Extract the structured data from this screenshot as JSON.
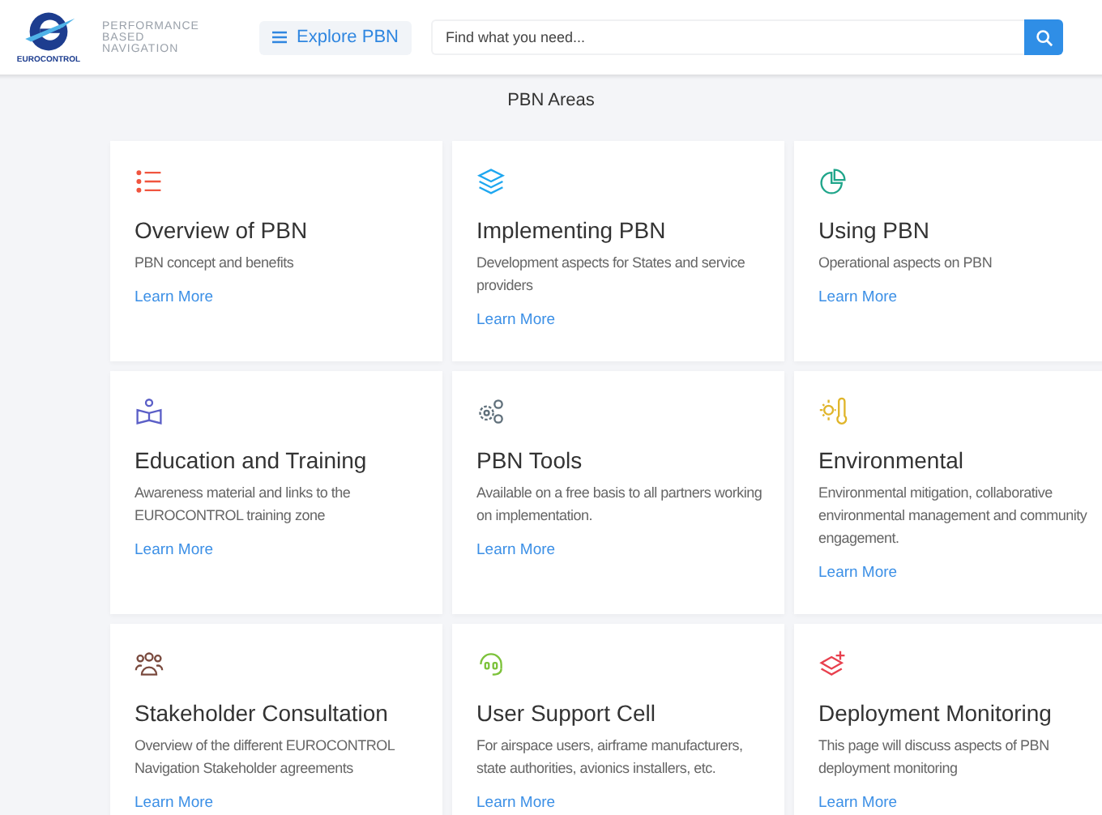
{
  "header": {
    "logo_caption": "EUROCONTROL",
    "site_name": [
      "PERFORMANCE",
      "BASED",
      "NAVIGATION"
    ],
    "menu_button": "Explore PBN",
    "search": {
      "placeholder": "Find what you need..."
    }
  },
  "section_title": "PBN Areas",
  "cards": [
    {
      "title": "Overview of PBN",
      "description": "PBN concept and benefits",
      "link": "Learn More",
      "color": "#f0553f"
    },
    {
      "title": "Implementing PBN",
      "description": "Development aspects for States and service providers",
      "link": "Learn More",
      "color": "#1ea7f0"
    },
    {
      "title": "Using PBN",
      "description": "Operational aspects on PBN",
      "link": "Learn More",
      "color": "#1fa58a"
    },
    {
      "title": "Education and Training",
      "description": "Awareness material and links to the EUROCONTROL training zone",
      "link": "Learn More",
      "color": "#5b5fc7"
    },
    {
      "title": "PBN Tools",
      "description": "Available on a free basis to all partners working on implementation.",
      "link": "Learn More",
      "color": "#5f6f7a"
    },
    {
      "title": "Environmental",
      "description": "Environmental mitigation, collaborative environmental management and community engagement.",
      "link": "Learn More",
      "color": "#e0b52a"
    },
    {
      "title": "Stakeholder Consultation",
      "description": "Overview of the different EUROCONTROL Navigation Stakeholder agreements",
      "link": "Learn More",
      "color": "#7a4a3e"
    },
    {
      "title": "User Support Cell",
      "description": "For airspace users, airframe manufacturers, state authorities, avionics installers, etc.",
      "link": "Learn More",
      "color": "#7cc23a"
    },
    {
      "title": "Deployment Monitoring",
      "description": "This page will discuss aspects of PBN deployment monitoring",
      "link": "Learn More",
      "color": "#e8404e"
    }
  ]
}
